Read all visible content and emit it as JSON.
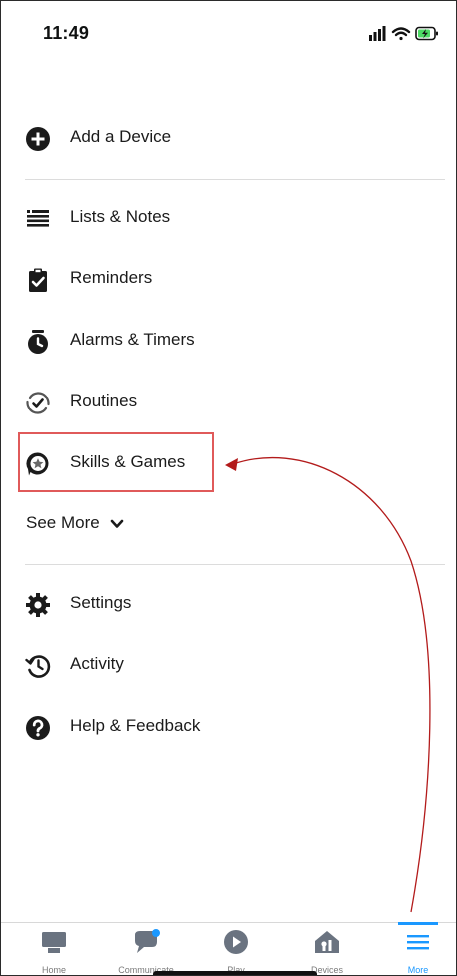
{
  "status_bar": {
    "time": "11:49"
  },
  "menu": {
    "add_device": "Add a Device",
    "lists_notes": "Lists & Notes",
    "reminders": "Reminders",
    "alarms_timers": "Alarms & Timers",
    "routines": "Routines",
    "skills_games": "Skills & Games",
    "see_more": "See More",
    "settings": "Settings",
    "activity": "Activity",
    "help_feedback": "Help & Feedback"
  },
  "tabs": {
    "home": "Home",
    "communicate": "Communicate",
    "play": "Play",
    "devices": "Devices",
    "more": "More"
  },
  "colors": {
    "accent": "#1a98ff",
    "highlight": "#e05a5a",
    "arrow": "#b31b1b",
    "icon_dark": "#1b1b1b",
    "tab_icon": "#6a7380"
  },
  "icons": [
    "add-device-icon",
    "list-icon",
    "reminder-icon",
    "alarm-icon",
    "routines-icon",
    "skills-icon",
    "chevron-down-icon",
    "settings-icon",
    "activity-icon",
    "help-icon",
    "home-icon",
    "communicate-icon",
    "play-icon",
    "devices-icon",
    "more-icon"
  ]
}
